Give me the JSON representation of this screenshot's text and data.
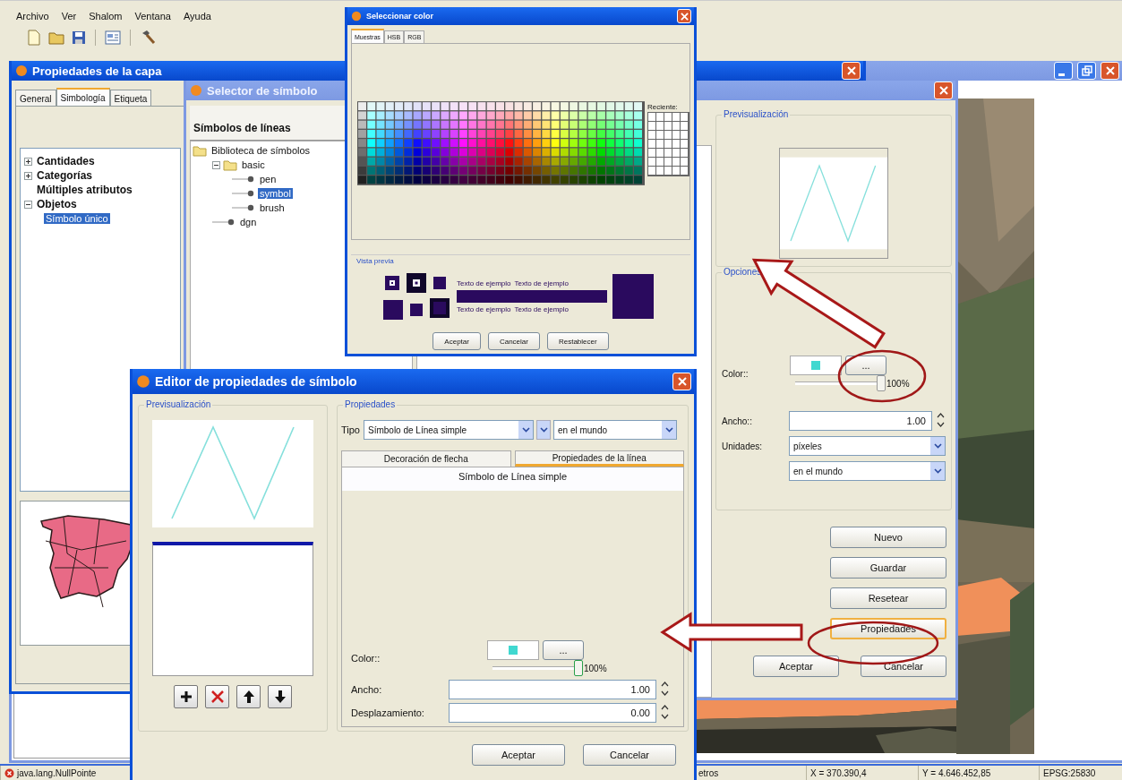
{
  "menu_bar": [
    {
      "label": "Archivo"
    },
    {
      "label": "Ver"
    },
    {
      "label": "Shalom"
    },
    {
      "label": "Ventana"
    },
    {
      "label": "Ayuda"
    }
  ],
  "layer_properties": {
    "title": "Propiedades de la capa",
    "active": true,
    "tabs": [
      {
        "label": "General",
        "selected": false
      },
      {
        "label": "Simbología",
        "selected": true
      },
      {
        "label": "Etiqueta",
        "selected": false
      }
    ],
    "legend_types": [
      {
        "label": "Cantidades",
        "expanded": false,
        "selected": false
      },
      {
        "label": "Categorías",
        "expanded": false,
        "selected": false
      },
      {
        "label": "Múltiples atributos",
        "selected": false
      },
      {
        "label": "Objetos",
        "expanded": true,
        "selected": false,
        "children": [
          {
            "label": "Símbolo único",
            "selected": true
          }
        ]
      }
    ]
  },
  "symbol_selector": {
    "title": "Selector de símbolo",
    "active": false,
    "library_title": "Símbolos de líneas",
    "library_tree": [
      {
        "label": "Biblioteca de símbolos",
        "kind": "folder",
        "selected": false,
        "children": [
          {
            "label": "basic",
            "kind": "folder",
            "expanded": true,
            "selected": false,
            "children": [
              {
                "label": "pen",
                "kind": "symbol",
                "selected": false
              },
              {
                "label": "symbol",
                "kind": "symbol",
                "selected": true
              },
              {
                "label": "brush",
                "kind": "symbol",
                "selected": false
              }
            ]
          },
          {
            "label": "dgn",
            "kind": "symbol",
            "selected": false
          }
        ]
      }
    ],
    "preview_label": "Previsualización",
    "options_label": "Opciones",
    "color_label": "Color::",
    "color_button": "...",
    "opacity": {
      "level": 1,
      "reading": "100%"
    },
    "width_label": "Ancho::",
    "width_value": "1.00",
    "units_label": "Unidades:",
    "units": "píxeles",
    "reference": "en el mundo",
    "buttons": [
      {
        "label": "Nuevo",
        "focused": false
      },
      {
        "label": "Guardar",
        "focused": false
      },
      {
        "label": "Resetear",
        "focused": false
      },
      {
        "label": "Propiedades",
        "focused": true
      }
    ],
    "footer_buttons": [
      "Aceptar",
      "Cancelar"
    ]
  },
  "color_chooser": {
    "title": "Seleccionar color",
    "active": true,
    "tabs": [
      {
        "label": "Muestras",
        "selected": true
      },
      {
        "label": "HSB",
        "selected": false
      },
      {
        "label": "RGB",
        "selected": false
      }
    ],
    "recent_label": "Reciente:",
    "preview_label": "Vista previa",
    "sample_texts": [
      "Texto de ejemplo",
      "Texto de ejemplo",
      "Texto de ejemplo",
      "Texto de ejemplo"
    ],
    "buttons": [
      "Aceptar",
      "Cancelar",
      "Restablecer"
    ]
  },
  "symbol_editor": {
    "title": "Editor de propiedades de símbolo",
    "active": true,
    "preview_label": "Previsualización",
    "properties_label": "Propiedades",
    "type_label": "Tipo",
    "type_value": "Símbolo de Línea simple",
    "units_value": "en el mundo",
    "tabs": [
      {
        "label": "Decoración de flecha",
        "selected": false
      },
      {
        "label": "Propiedades de la línea",
        "selected": true
      }
    ],
    "panel_title": "Símbolo de Línea simple",
    "color_label": "Color::",
    "color_button": "...",
    "opacity": {
      "level": 1,
      "reading": "100%"
    },
    "fields": [
      {
        "label": "Ancho:",
        "value": "1.00"
      },
      {
        "label": "Desplazamiento:",
        "value": "0.00"
      }
    ],
    "buttons": [
      "Aceptar",
      "Cancelar"
    ]
  },
  "status_bar": [
    {
      "text": "java.lang.NullPointe",
      "kind": "error"
    },
    {
      "text": "etros",
      "kind": "plain"
    },
    {
      "text": "X = 370.390,4",
      "kind": "plain"
    },
    {
      "text": "Y = 4.646.452,85",
      "kind": "plain"
    },
    {
      "text": "EPSG:25830",
      "kind": "plain"
    }
  ]
}
